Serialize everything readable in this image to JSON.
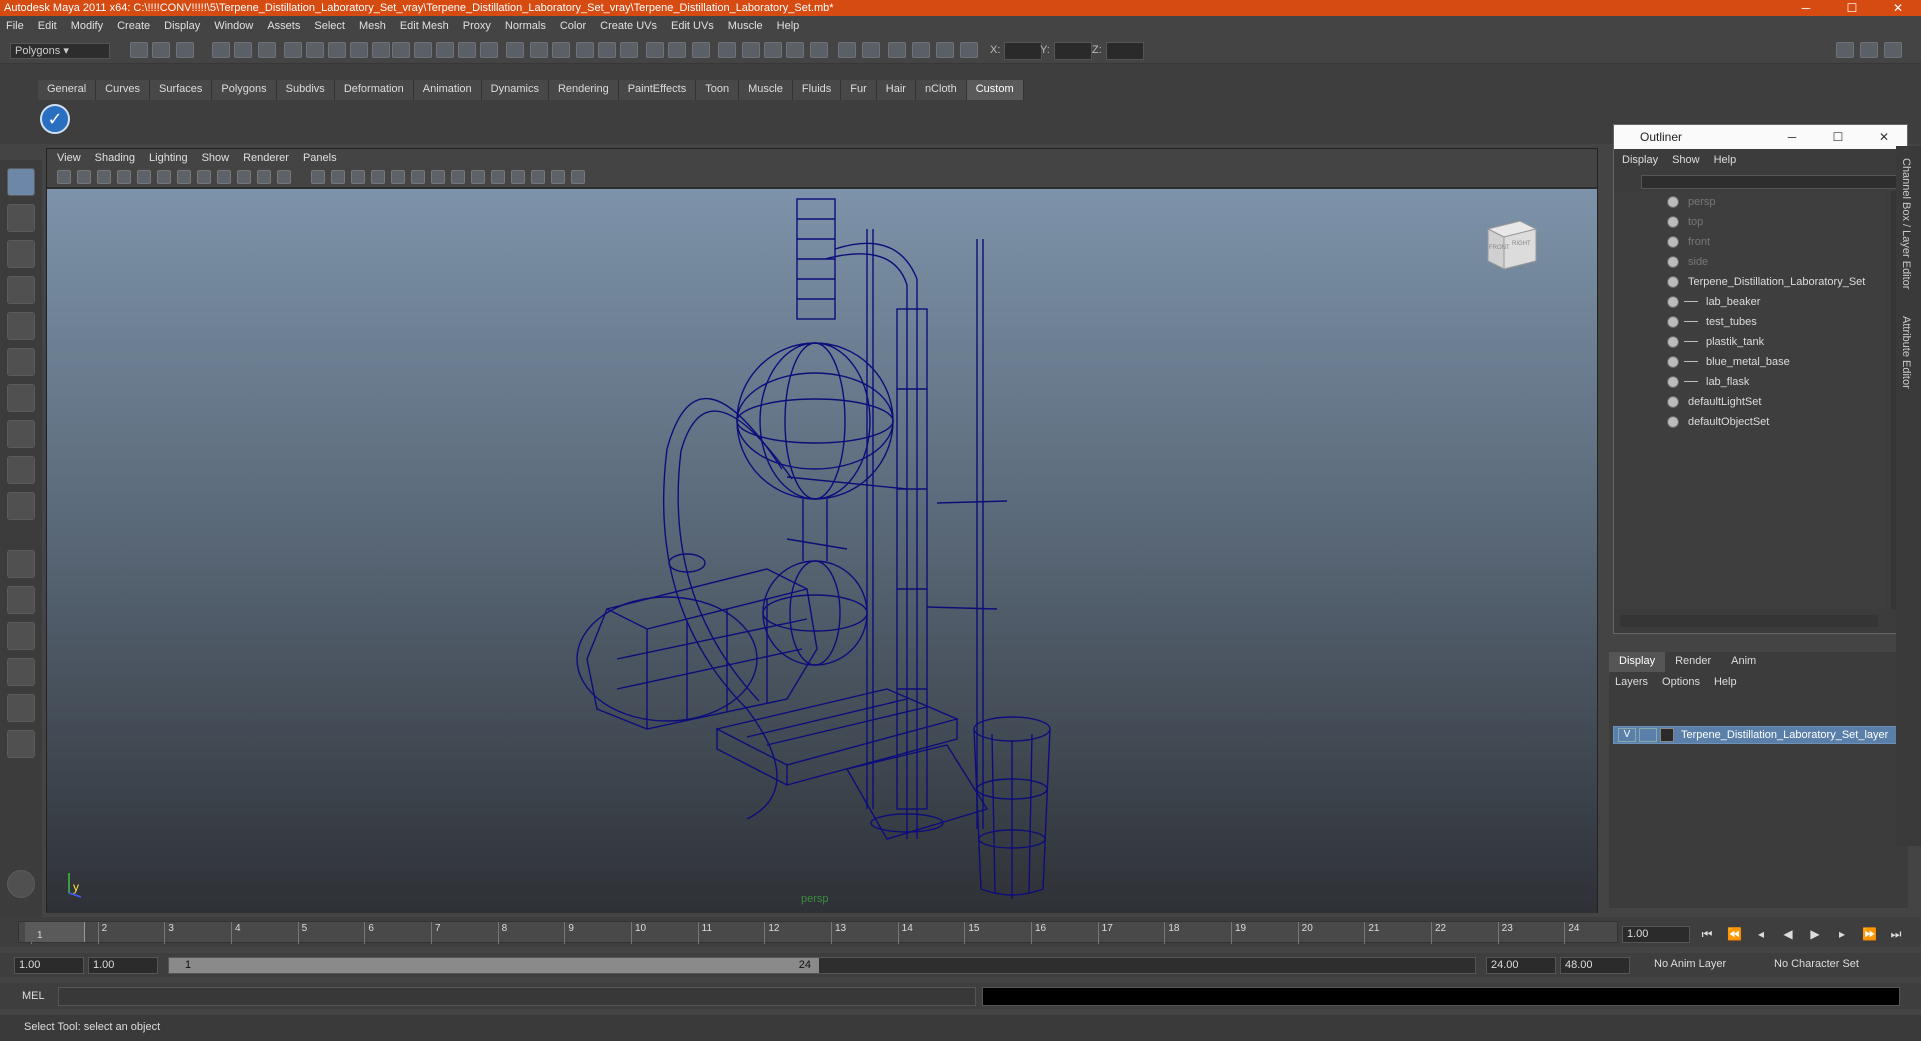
{
  "window": {
    "title": "Autodesk Maya 2011 x64: C:\\!!!!CONV!!!!!\\5\\Terpene_Distillation_Laboratory_Set_vray\\Terpene_Distillation_Laboratory_Set_vray\\Terpene_Distillation_Laboratory_Set.mb*",
    "minimize": "─",
    "maximize": "☐",
    "close": "✕"
  },
  "menubar": [
    "File",
    "Edit",
    "Modify",
    "Create",
    "Display",
    "Window",
    "Assets",
    "Select",
    "Mesh",
    "Edit Mesh",
    "Proxy",
    "Normals",
    "Color",
    "Create UVs",
    "Edit UVs",
    "Muscle",
    "Help"
  ],
  "toolbar": {
    "context": "Polygons",
    "x_label": "X:",
    "y_label": "Y:",
    "z_label": "Z:"
  },
  "shelf": {
    "tabs": [
      "General",
      "Curves",
      "Surfaces",
      "Polygons",
      "Subdivs",
      "Deformation",
      "Animation",
      "Dynamics",
      "Rendering",
      "PaintEffects",
      "Toon",
      "Muscle",
      "Fluids",
      "Fur",
      "Hair",
      "nCloth",
      "Custom"
    ],
    "active_tab": "Custom"
  },
  "viewport": {
    "menu": [
      "View",
      "Shading",
      "Lighting",
      "Show",
      "Renderer",
      "Panels"
    ],
    "camera_label": "persp",
    "viewcube_front": "FRONT",
    "viewcube_right": "RIGHT",
    "axis_y": "y",
    "wire_color": "#0d0d7a"
  },
  "outliner": {
    "title": "Outliner",
    "menu": [
      "Display",
      "Show",
      "Help"
    ],
    "items": [
      {
        "label": "persp",
        "indent": 0,
        "dim": true
      },
      {
        "label": "top",
        "indent": 0,
        "dim": true
      },
      {
        "label": "front",
        "indent": 0,
        "dim": true
      },
      {
        "label": "side",
        "indent": 0,
        "dim": true
      },
      {
        "label": "Terpene_Distillation_Laboratory_Set",
        "indent": 0,
        "dim": false
      },
      {
        "label": "lab_beaker",
        "indent": 1,
        "dim": false
      },
      {
        "label": "test_tubes",
        "indent": 1,
        "dim": false
      },
      {
        "label": "plastik_tank",
        "indent": 1,
        "dim": false
      },
      {
        "label": "blue_metal_base",
        "indent": 1,
        "dim": false
      },
      {
        "label": "lab_flask",
        "indent": 1,
        "dim": false
      },
      {
        "label": "defaultLightSet",
        "indent": 0,
        "dim": false
      },
      {
        "label": "defaultObjectSet",
        "indent": 0,
        "dim": false
      }
    ]
  },
  "layers": {
    "tabs": [
      "Display",
      "Render",
      "Anim"
    ],
    "active_tab": "Display",
    "menu": [
      "Layers",
      "Options",
      "Help"
    ],
    "row": {
      "visible": "V",
      "name": "Terpene_Distillation_Laboratory_Set_layer"
    }
  },
  "right_strip": {
    "channel_box": "Channel Box / Layer Editor",
    "attribute_editor": "Attribute Editor"
  },
  "timeline": {
    "ticks": [
      "1",
      "2",
      "3",
      "4",
      "5",
      "6",
      "7",
      "8",
      "9",
      "10",
      "11",
      "12",
      "13",
      "14",
      "15",
      "16",
      "17",
      "18",
      "19",
      "20",
      "21",
      "22",
      "23",
      "24"
    ],
    "current_marker": "1",
    "current_frame": "1.00"
  },
  "range": {
    "start": "1.00",
    "playback_start": "1.00",
    "handle_start": "1",
    "handle_end": "24",
    "playback_end": "24.00",
    "end": "48.00",
    "anim_layer": "No Anim Layer",
    "character_set": "No Character Set"
  },
  "command": {
    "label": "MEL"
  },
  "status": {
    "help": "Select Tool: select an object"
  }
}
